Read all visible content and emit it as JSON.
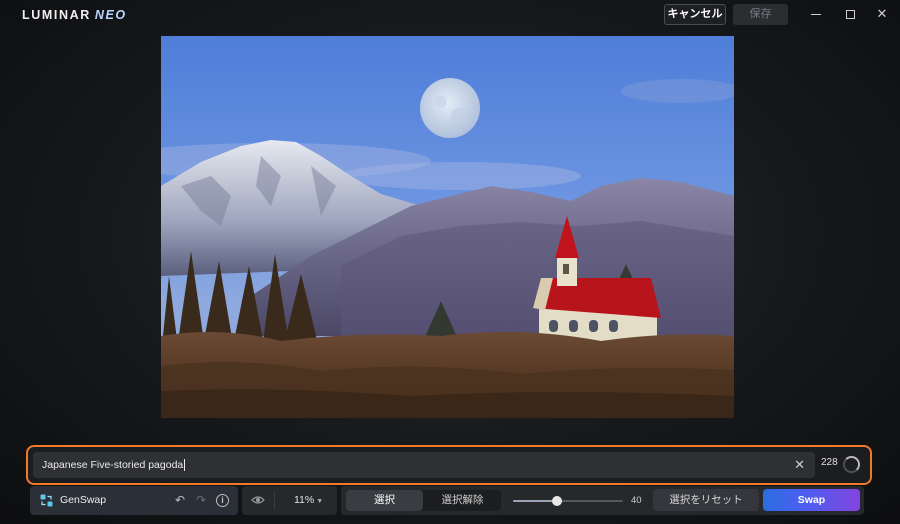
{
  "app": {
    "logo_main": "LUMINAR",
    "logo_accent": "NEO"
  },
  "titlebar": {
    "cancel_label": "キャンセル",
    "save_label": "保存",
    "save_enabled": false
  },
  "prompt": {
    "value": "Japanese Five-storied pagoda",
    "count": "228",
    "highlight_color": "#f07a28"
  },
  "toolbar": {
    "tool_name": "GenSwap",
    "zoom": "11%",
    "select_on_label": "選択",
    "select_off_label": "選択解除",
    "brush_size": "40",
    "brush_size_max": 100,
    "reset_selection_label": "選択をリセット",
    "swap_label": "Swap"
  },
  "icons": {
    "genswap": "genswap-icon",
    "undo": "undo-icon",
    "redo": "redo-icon",
    "info": "info-icon",
    "visibility": "eye-icon",
    "clear": "close-icon",
    "progress": "spinner-icon"
  }
}
